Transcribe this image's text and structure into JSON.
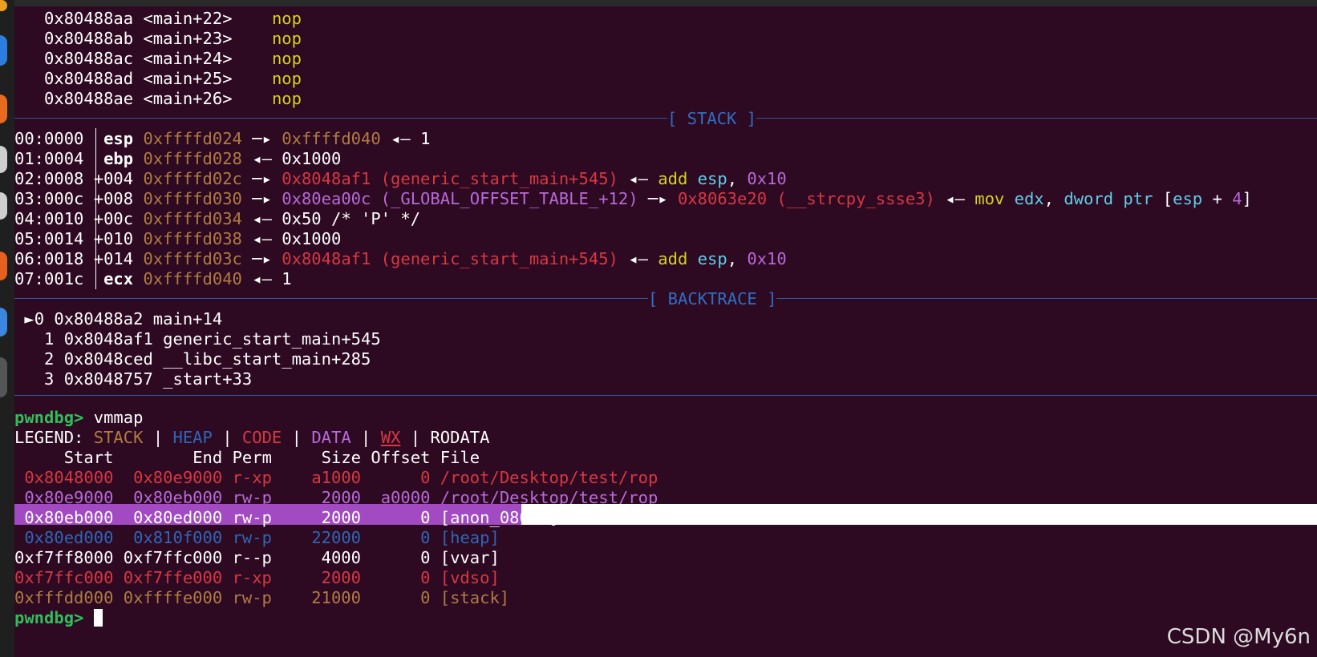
{
  "disasm": [
    {
      "addr": "0x80488aa",
      "sym": "<main+22>",
      "mnem": "nop"
    },
    {
      "addr": "0x80488ab",
      "sym": "<main+23>",
      "mnem": "nop"
    },
    {
      "addr": "0x80488ac",
      "sym": "<main+24>",
      "mnem": "nop"
    },
    {
      "addr": "0x80488ad",
      "sym": "<main+25>",
      "mnem": "nop"
    },
    {
      "addr": "0x80488ae",
      "sym": "<main+26>",
      "mnem": "nop"
    }
  ],
  "stack_title": "[ STACK ]",
  "stack": [
    {
      "idx": "00:0000",
      "reg": "esp",
      "addr": "0xffffd024"
    },
    {
      "idx": "01:0004",
      "reg": "ebp",
      "addr": "0xffffd028"
    },
    {
      "idx": "02:0008",
      "reg": "+004",
      "addr": "0xffffd02c"
    },
    {
      "idx": "03:000c",
      "reg": "+008",
      "addr": "0xffffd030"
    },
    {
      "idx": "04:0010",
      "reg": "+00c",
      "addr": "0xffffd034"
    },
    {
      "idx": "05:0014",
      "reg": "+010",
      "addr": "0xffffd038"
    },
    {
      "idx": "06:0018",
      "reg": "+014",
      "addr": "0xffffd03c"
    },
    {
      "idx": "07:001c",
      "reg": "ecx",
      "addr": "0xffffd040"
    }
  ],
  "stack_detail": {
    "r0_ptr": "0xffffd040",
    "r0_val": "1",
    "r1_val": "0x1000",
    "r2_ptr": "0x8048af1 (generic_start_main+545)",
    "r2_op": "add",
    "r2_reg": "esp",
    "r2_imm": "0x10",
    "r3_ptr": "0x80ea00c (_GLOBAL_OFFSET_TABLE_+12)",
    "r3_ptr2": "0x8063e20 (__strcpy_ssse3)",
    "r3_op": "mov",
    "r3_reg": "edx",
    "r3_size": "dword ptr",
    "r3_lb": "[",
    "r3_reg2": "esp",
    "r3_plus": "+",
    "r3_imm": "4",
    "r3_rb": "]",
    "r4_val": "0x50 /* 'P' */",
    "r5_val": "0x1000",
    "r6_ptr": "0x8048af1 (generic_start_main+545)",
    "r6_op": "add",
    "r6_reg": "esp",
    "r6_imm": "0x10",
    "r7_val": "1"
  },
  "backtrace_title": "[ BACKTRACE ]",
  "backtrace": [
    {
      "line": "0 0x80488a2 main+14"
    },
    {
      "line": "1 0x8048af1 generic_start_main+545"
    },
    {
      "line": "2 0x8048ced __libc_start_main+285"
    },
    {
      "line": "3 0x8048757 _start+33"
    }
  ],
  "prompt": "pwndbg>",
  "command": "vmmap",
  "legend": {
    "label": "LEGEND:",
    "stack": "STACK",
    "heap": "HEAP",
    "code": "CODE",
    "data": "DATA",
    "wx": "WX",
    "rodata": "RODATA",
    "sep": "|"
  },
  "vmmap_header": {
    "start": "Start",
    "end": "End",
    "perm": "Perm",
    "size": "Size",
    "offset": "Offset",
    "file": "File"
  },
  "vmmap": [
    {
      "start": "0x8048000",
      "end": "0x80e9000",
      "perm": "r-xp",
      "size": "a1000",
      "offset": "0",
      "file": "/root/Desktop/test/rop"
    },
    {
      "start": "0x80e9000",
      "end": "0x80eb000",
      "perm": "rw-p",
      "size": "2000",
      "offset": "a0000",
      "file": "/root/Desktop/test/rop"
    },
    {
      "start": "0x80eb000",
      "end": "0x80ed000",
      "perm": "rw-p",
      "size": "2000",
      "offset": "0",
      "file": "[anon_080eb]"
    },
    {
      "start": "0x80ed000",
      "end": "0x810f000",
      "perm": "rw-p",
      "size": "22000",
      "offset": "0",
      "file": "[heap]"
    },
    {
      "start": "0xf7ff8000",
      "end": "0xf7ffc000",
      "perm": "r--p",
      "size": "4000",
      "offset": "0",
      "file": "[vvar]"
    },
    {
      "start": "0xf7ffc000",
      "end": "0xf7ffe000",
      "perm": "r-xp",
      "size": "2000",
      "offset": "0",
      "file": "[vdso]"
    },
    {
      "start": "0xfffdd000",
      "end": "0xffffe000",
      "perm": "rw-p",
      "size": "21000",
      "offset": "0",
      "file": "[stack]"
    }
  ],
  "watermark": "CSDN @My6n",
  "colors": {
    "background": "#2d0922",
    "stack": "#b07c42",
    "heap": "#2e66b8",
    "code": "#d83843",
    "data": "#b76ad8",
    "highlight": "#a24ac2",
    "prompt": "#2fbf5a"
  }
}
